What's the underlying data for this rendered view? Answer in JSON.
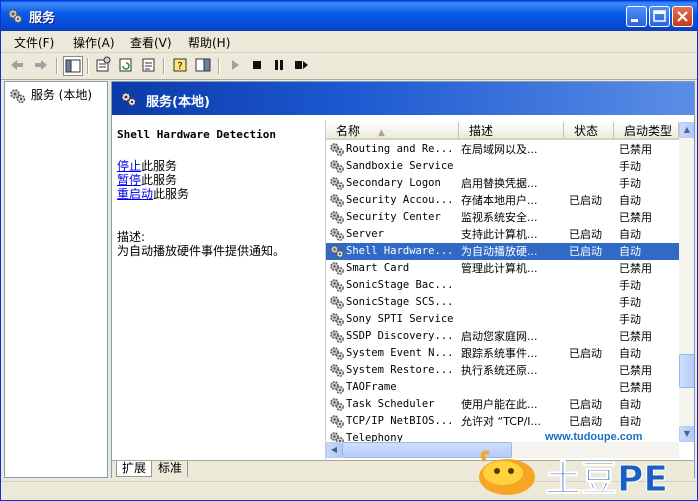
{
  "window": {
    "title": "服务"
  },
  "menu": [
    {
      "label": "文件(F)"
    },
    {
      "label": "操作(A)"
    },
    {
      "label": "查看(V)"
    },
    {
      "label": "帮助(H)"
    }
  ],
  "tree": {
    "root_label": "服务 (本地)"
  },
  "header": {
    "title": "服务(本地)"
  },
  "details": {
    "service_title": "Shell Hardware Detection",
    "actions": [
      {
        "link": "停止",
        "rest": "此服务"
      },
      {
        "link": "暂停",
        "rest": "此服务"
      },
      {
        "link": "重启动",
        "rest": "此服务"
      }
    ],
    "description_label": "描述:",
    "description_text": "为自动播放硬件事件提供通知。"
  },
  "columns": [
    "名称",
    "描述",
    "状态",
    "启动类型"
  ],
  "services": [
    {
      "name": "Routing and Re...",
      "desc": "在局域网以及...",
      "status": "",
      "startup": "已禁用"
    },
    {
      "name": "Sandboxie Service",
      "desc": "",
      "status": "",
      "startup": "手动"
    },
    {
      "name": "Secondary Logon",
      "desc": "启用替换凭据...",
      "status": "",
      "startup": "手动"
    },
    {
      "name": "Security Accou...",
      "desc": "存储本地用户...",
      "status": "已启动",
      "startup": "自动"
    },
    {
      "name": "Security Center",
      "desc": "监视系统安全...",
      "status": "",
      "startup": "已禁用"
    },
    {
      "name": "Server",
      "desc": "支持此计算机...",
      "status": "已启动",
      "startup": "自动"
    },
    {
      "name": "Shell Hardware...",
      "desc": "为自动播放硬...",
      "status": "已启动",
      "startup": "自动"
    },
    {
      "name": "Smart Card",
      "desc": "管理此计算机...",
      "status": "",
      "startup": "已禁用"
    },
    {
      "name": "SonicStage Bac...",
      "desc": "",
      "status": "",
      "startup": "手动"
    },
    {
      "name": "SonicStage SCS...",
      "desc": "",
      "status": "",
      "startup": "手动"
    },
    {
      "name": "Sony SPTI Service",
      "desc": "",
      "status": "",
      "startup": "手动"
    },
    {
      "name": "SSDP Discovery...",
      "desc": "启动您家庭网...",
      "status": "",
      "startup": "已禁用"
    },
    {
      "name": "System Event N...",
      "desc": "跟踪系统事件...",
      "status": "已启动",
      "startup": "自动"
    },
    {
      "name": "System Restore...",
      "desc": "执行系统还原...",
      "status": "",
      "startup": "已禁用"
    },
    {
      "name": "TAOFrame",
      "desc": "",
      "status": "",
      "startup": "已禁用"
    },
    {
      "name": "Task Scheduler",
      "desc": "使用户能在此...",
      "status": "已启动",
      "startup": "自动"
    },
    {
      "name": "TCP/IP NetBIOS...",
      "desc": "允许对 “TCP/I...",
      "status": "已启动",
      "startup": "自动"
    },
    {
      "name": "Telephony",
      "desc": "",
      "status": "",
      "startup": ""
    }
  ],
  "selected_index": 6,
  "tabs": [
    {
      "label": "扩展",
      "active": true
    },
    {
      "label": "标准",
      "active": false
    }
  ],
  "watermark": {
    "url": "www.tudoupe.com",
    "brand": "土豆PE"
  },
  "colors": {
    "title_blue": "#0a5ae8",
    "selection": "#316ac5",
    "link": "#0000ee"
  }
}
